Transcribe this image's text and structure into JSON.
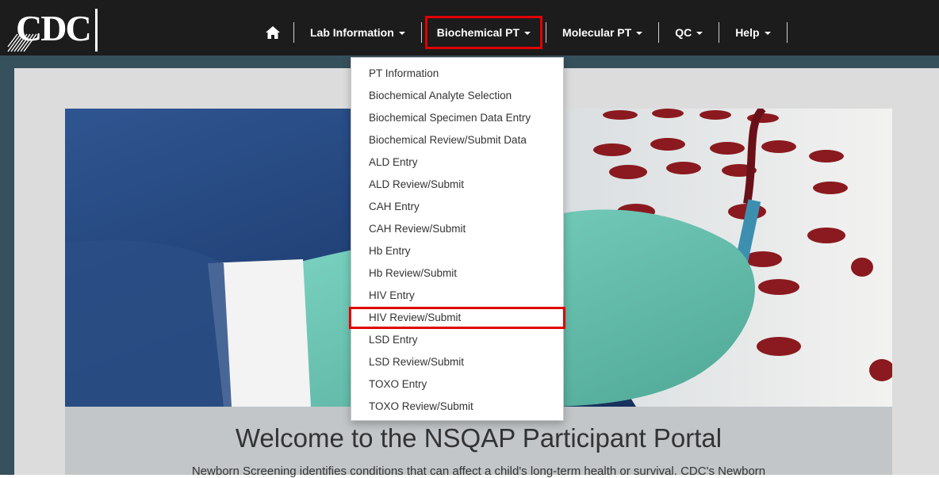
{
  "logo": {
    "text": "CDC"
  },
  "nav": {
    "home_icon": "home-icon",
    "items": [
      {
        "label": "Lab Information",
        "has_caret": true
      },
      {
        "label": "Biochemical PT",
        "has_caret": true,
        "highlighted": true
      },
      {
        "label": "Molecular PT",
        "has_caret": true
      },
      {
        "label": "QC",
        "has_caret": true
      },
      {
        "label": "Help",
        "has_caret": true
      }
    ]
  },
  "dropdown": {
    "items": [
      "PT Information",
      "Biochemical Analyte Selection",
      "Biochemical Specimen Data Entry",
      "Biochemical Review/Submit Data",
      "ALD Entry",
      "ALD Review/Submit",
      "CAH Entry",
      "CAH Review/Submit",
      "Hb Entry",
      "Hb Review/Submit",
      "HIV Entry",
      "HIV Review/Submit",
      "LSD Entry",
      "LSD Review/Submit",
      "TOXO Entry",
      "TOXO Review/Submit"
    ],
    "highlighted_item": "HIV Review/Submit"
  },
  "main": {
    "welcome_title": "Welcome to the NSQAP Participant Portal",
    "welcome_subtitle": "Newborn Screening identifies conditions that can affect a child's long-term health or survival. CDC's Newborn"
  },
  "colors": {
    "navbar": "#1c1c1c",
    "highlight_border": "#e00000",
    "page_background": "#36505c",
    "panel": "#dcdcdc"
  }
}
